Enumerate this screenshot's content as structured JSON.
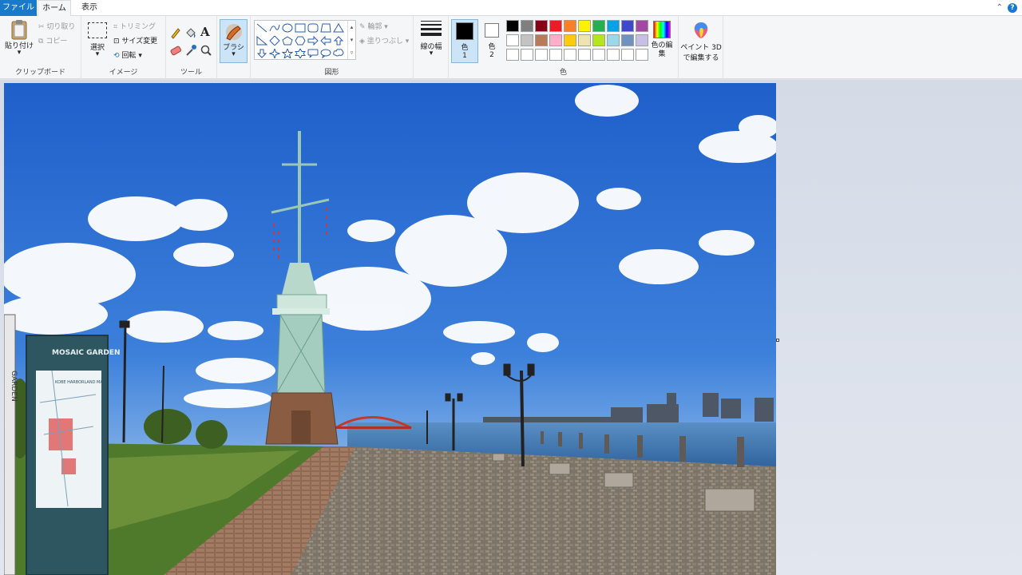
{
  "tabs": {
    "file": "ファイル",
    "home": "ホーム",
    "view": "表示"
  },
  "clipboard": {
    "paste": "貼り付け",
    "cut": "切り取り",
    "copy": "コピー",
    "label": "クリップボード"
  },
  "image": {
    "select": "選択",
    "crop": "トリミング",
    "resize": "サイズ変更",
    "rotate": "回転",
    "label": "イメージ"
  },
  "tools": {
    "label": "ツール"
  },
  "brushes": {
    "label": "ブラシ"
  },
  "shapes": {
    "outline": "輪郭",
    "fill": "塗りつぶし",
    "label": "図形"
  },
  "size": {
    "label": "線の幅"
  },
  "colors": {
    "color1_label": "色",
    "color1_num": "1",
    "color2_label": "色",
    "color2_num": "2",
    "edit": "色の編集",
    "label": "色",
    "color1": "#000000",
    "color2": "#ffffff",
    "palette": [
      "#000000",
      "#7f7f7f",
      "#880015",
      "#ed1c24",
      "#ff7f27",
      "#fff200",
      "#22b14c",
      "#00a2e8",
      "#3f48cc",
      "#a349a4",
      "#ffffff",
      "#c3c3c3",
      "#b97a57",
      "#ffaec9",
      "#ffc90e",
      "#efe4b0",
      "#b5e61d",
      "#99d9ea",
      "#7092be",
      "#c8bfe7"
    ]
  },
  "paint3d": {
    "line1": "ペイント 3D",
    "line2": "で編集する"
  },
  "canvas": {
    "photo_sign_title": "MOSAIC GARDEN",
    "photo_sign_sub": "KOBE HARBORLAND MAP",
    "photo_sign_side": "GARDEN"
  }
}
